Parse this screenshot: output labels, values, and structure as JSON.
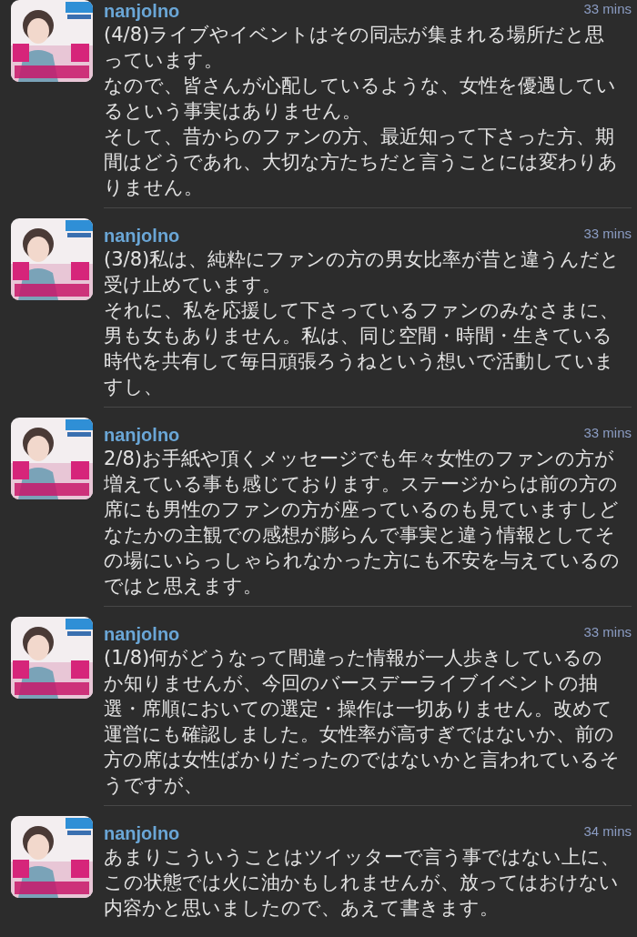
{
  "tweets": [
    {
      "username": "nanjolno",
      "time": "33 mins",
      "paragraphs": [
        "(4/8)ライブやイベントはその同志が集まれる場所だと思っています。",
        "なので、皆さんが心配しているような、女性を優遇しているという事実はありません。",
        "そして、昔からのファンの方、最近知って下さった方、期間はどうであれ、大切な方たちだと言うことには変わりありません。"
      ]
    },
    {
      "username": "nanjolno",
      "time": "33 mins",
      "paragraphs": [
        "(3/8)私は、純粋にファンの方の男女比率が昔と違うんだと受け止めています。",
        "それに、私を応援して下さっているファンのみなさまに、男も女もありません。私は、同じ空間・時間・生きている時代を共有して毎日頑張ろうねという想いで活動していますし、"
      ]
    },
    {
      "username": "nanjolno",
      "time": "33 mins",
      "paragraphs": [
        "2/8)お手紙や頂くメッセージでも年々女性のファンの方が増えている事も感じております。ステージからは前の方の席にも男性のファンの方が座っているのも見ていますしどなたかの主観での感想が膨らんで事実と違う情報としてその場にいらっしゃられなかった方にも不安を与えているのではと思えます。"
      ]
    },
    {
      "username": "nanjolno",
      "time": "33 mins",
      "paragraphs": [
        "(1/8)何がどうなって間違った情報が一人歩きしているのか知りませんが、今回のバースデーライブイベントの抽選・席順においての選定・操作は一切ありません。改めて運営にも確認しました。女性率が高すぎではないか、前の方の席は女性ばかりだったのではないかと言われているそうですが、"
      ]
    },
    {
      "username": "nanjolno",
      "time": "34 mins",
      "paragraphs": [
        "あまりこういうことはツイッターで言う事ではない上に、この状態では火に油かもしれませんが、放ってはおけない内容かと思いましたので、あえて書きます。"
      ]
    }
  ]
}
